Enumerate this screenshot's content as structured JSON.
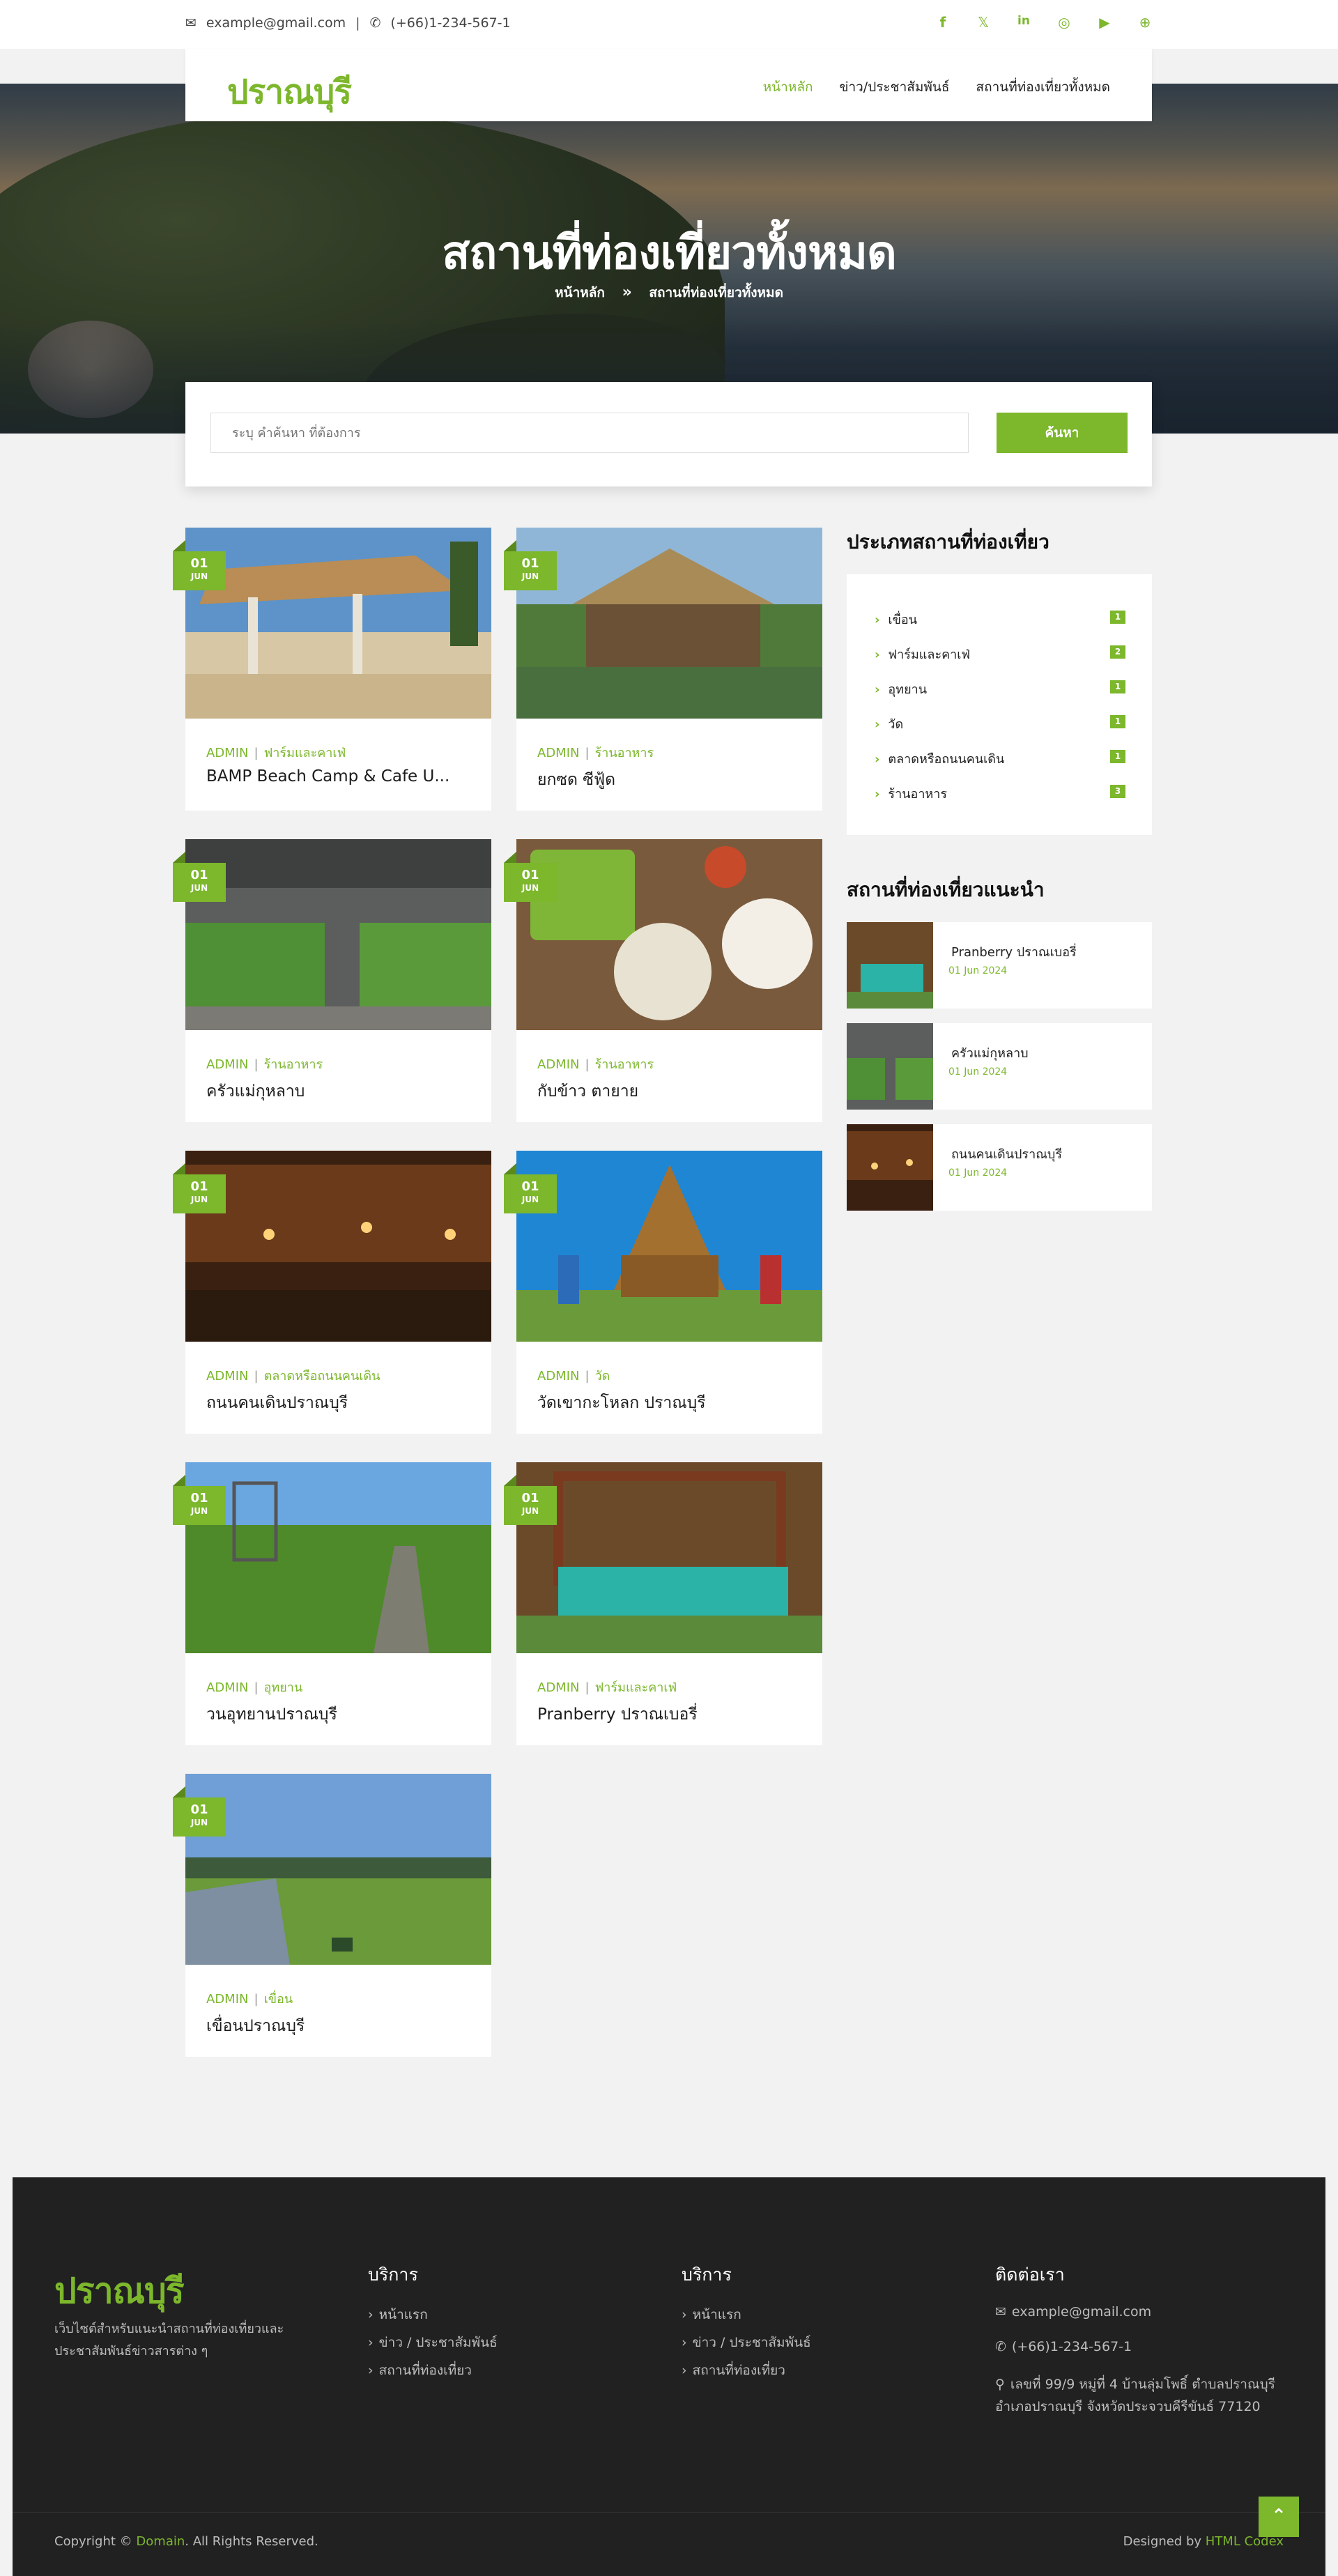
{
  "topbar": {
    "email": "example@gmail.com",
    "phone": "(+66)1-234-567-1",
    "separator": "|"
  },
  "brand": {
    "logo": "ปราณบุรี"
  },
  "nav": {
    "items": [
      {
        "label": "หน้าหลัก",
        "active": true
      },
      {
        "label": "ข่าว/ประชาสัมพันธ์",
        "active": false
      },
      {
        "label": "สถานที่ท่องเที่ยวทั้งหมด",
        "active": false
      }
    ]
  },
  "hero": {
    "title": "สถานที่ท่องเที่ยวทั้งหมด",
    "breadcrumb_home": "หน้าหลัก",
    "breadcrumb_current": "สถานที่ท่องเที่ยวทั้งหมด"
  },
  "search": {
    "placeholder": "ระบุ คำค้นหา ที่ต้องการ",
    "button": "ค้นหา"
  },
  "cards": [
    {
      "day": "01",
      "month": "JUN",
      "author": "ADMIN",
      "category": "ฟาร์มและคาเฟ่",
      "title": "BAMP Beach Camp & Cafe U..."
    },
    {
      "day": "01",
      "month": "JUN",
      "author": "ADMIN",
      "category": "ร้านอาหาร",
      "title": "ยกซด ซีฟู้ด"
    },
    {
      "day": "01",
      "month": "JUN",
      "author": "ADMIN",
      "category": "ร้านอาหาร",
      "title": "ครัวแม่กุหลาบ"
    },
    {
      "day": "01",
      "month": "JUN",
      "author": "ADMIN",
      "category": "ร้านอาหาร",
      "title": "กับข้าว ตายาย"
    },
    {
      "day": "01",
      "month": "JUN",
      "author": "ADMIN",
      "category": "ตลาดหรือถนนคนเดิน",
      "title": "ถนนคนเดินปราณบุรี"
    },
    {
      "day": "01",
      "month": "JUN",
      "author": "ADMIN",
      "category": "วัด",
      "title": "วัดเขากะโหลก ปราณบุรี"
    },
    {
      "day": "01",
      "month": "JUN",
      "author": "ADMIN",
      "category": "อุทยาน",
      "title": "วนอุทยานปราณบุรี"
    },
    {
      "day": "01",
      "month": "JUN",
      "author": "ADMIN",
      "category": "ฟาร์มและคาเฟ่",
      "title": "Pranberry ปราณเบอรี่"
    },
    {
      "day": "01",
      "month": "JUN",
      "author": "ADMIN",
      "category": "เขื่อน",
      "title": "เขื่อนปราณบุรี"
    }
  ],
  "sidebar": {
    "categories_title": "ประเภทสถานที่ท่องเที่ยว",
    "categories": [
      {
        "label": "เขื่อน",
        "count": "1"
      },
      {
        "label": "ฟาร์มและคาเฟ่",
        "count": "2"
      },
      {
        "label": "อุทยาน",
        "count": "1"
      },
      {
        "label": "วัด",
        "count": "1"
      },
      {
        "label": "ตลาดหรือถนนคนเดิน",
        "count": "1"
      },
      {
        "label": "ร้านอาหาร",
        "count": "3"
      }
    ],
    "recommended_title": "สถานที่ท่องเที่ยวแนะนำ",
    "recommended": [
      {
        "title": "Pranberry ปราณเบอรี่",
        "date": "01 Jun 2024"
      },
      {
        "title": "ครัวแม่กุหลาบ",
        "date": "01 Jun 2024"
      },
      {
        "title": "ถนนคนเดินปราณบุรี",
        "date": "01 Jun 2024"
      }
    ]
  },
  "footer": {
    "logo": "ปราณบุรี",
    "description": "เว็บไซต์สำหรับแนะนำสถานที่ท่องเที่ยวและประชาสัมพันธ์ข่าวสารต่าง ๆ",
    "col1_title": "บริการ",
    "col1_links": [
      "หน้าแรก",
      "ข่าว / ประชาสัมพันธ์",
      "สถานที่ท่องเที่ยว"
    ],
    "col2_title": "บริการ",
    "col2_links": [
      "หน้าแรก",
      "ข่าว / ประชาสัมพันธ์",
      "สถานที่ท่องเที่ยว"
    ],
    "contact_title": "ติดต่อเรา",
    "contact_email": "example@gmail.com",
    "contact_phone": "(+66)1-234-567-1",
    "contact_address_1": "เลขที่ 99/9 หมู่ที่ 4 บ้านลุ่มโพธิ์ ตำบลปราณบุรี",
    "contact_address_2": "อำเภอปราณบุรี จังหวัดประจวบคีรีขันธ์ 77120",
    "copyright_prefix": "Copyright ©",
    "copyright_domain": "Domain",
    "copyright_suffix": ". All Rights Reserved.",
    "designed_prefix": "Designed by",
    "designed_by": "HTML Codex"
  },
  "icons": {
    "email": "envelope-icon",
    "phone": "phone-icon",
    "social": [
      "facebook-icon",
      "x-icon",
      "linkedin-icon",
      "instagram-icon",
      "youtube-icon",
      "globe-icon"
    ],
    "back_to_top": "double-chevron-up-icon"
  },
  "colors": {
    "accent": "#7cb72c",
    "footer_bg": "#212121"
  }
}
